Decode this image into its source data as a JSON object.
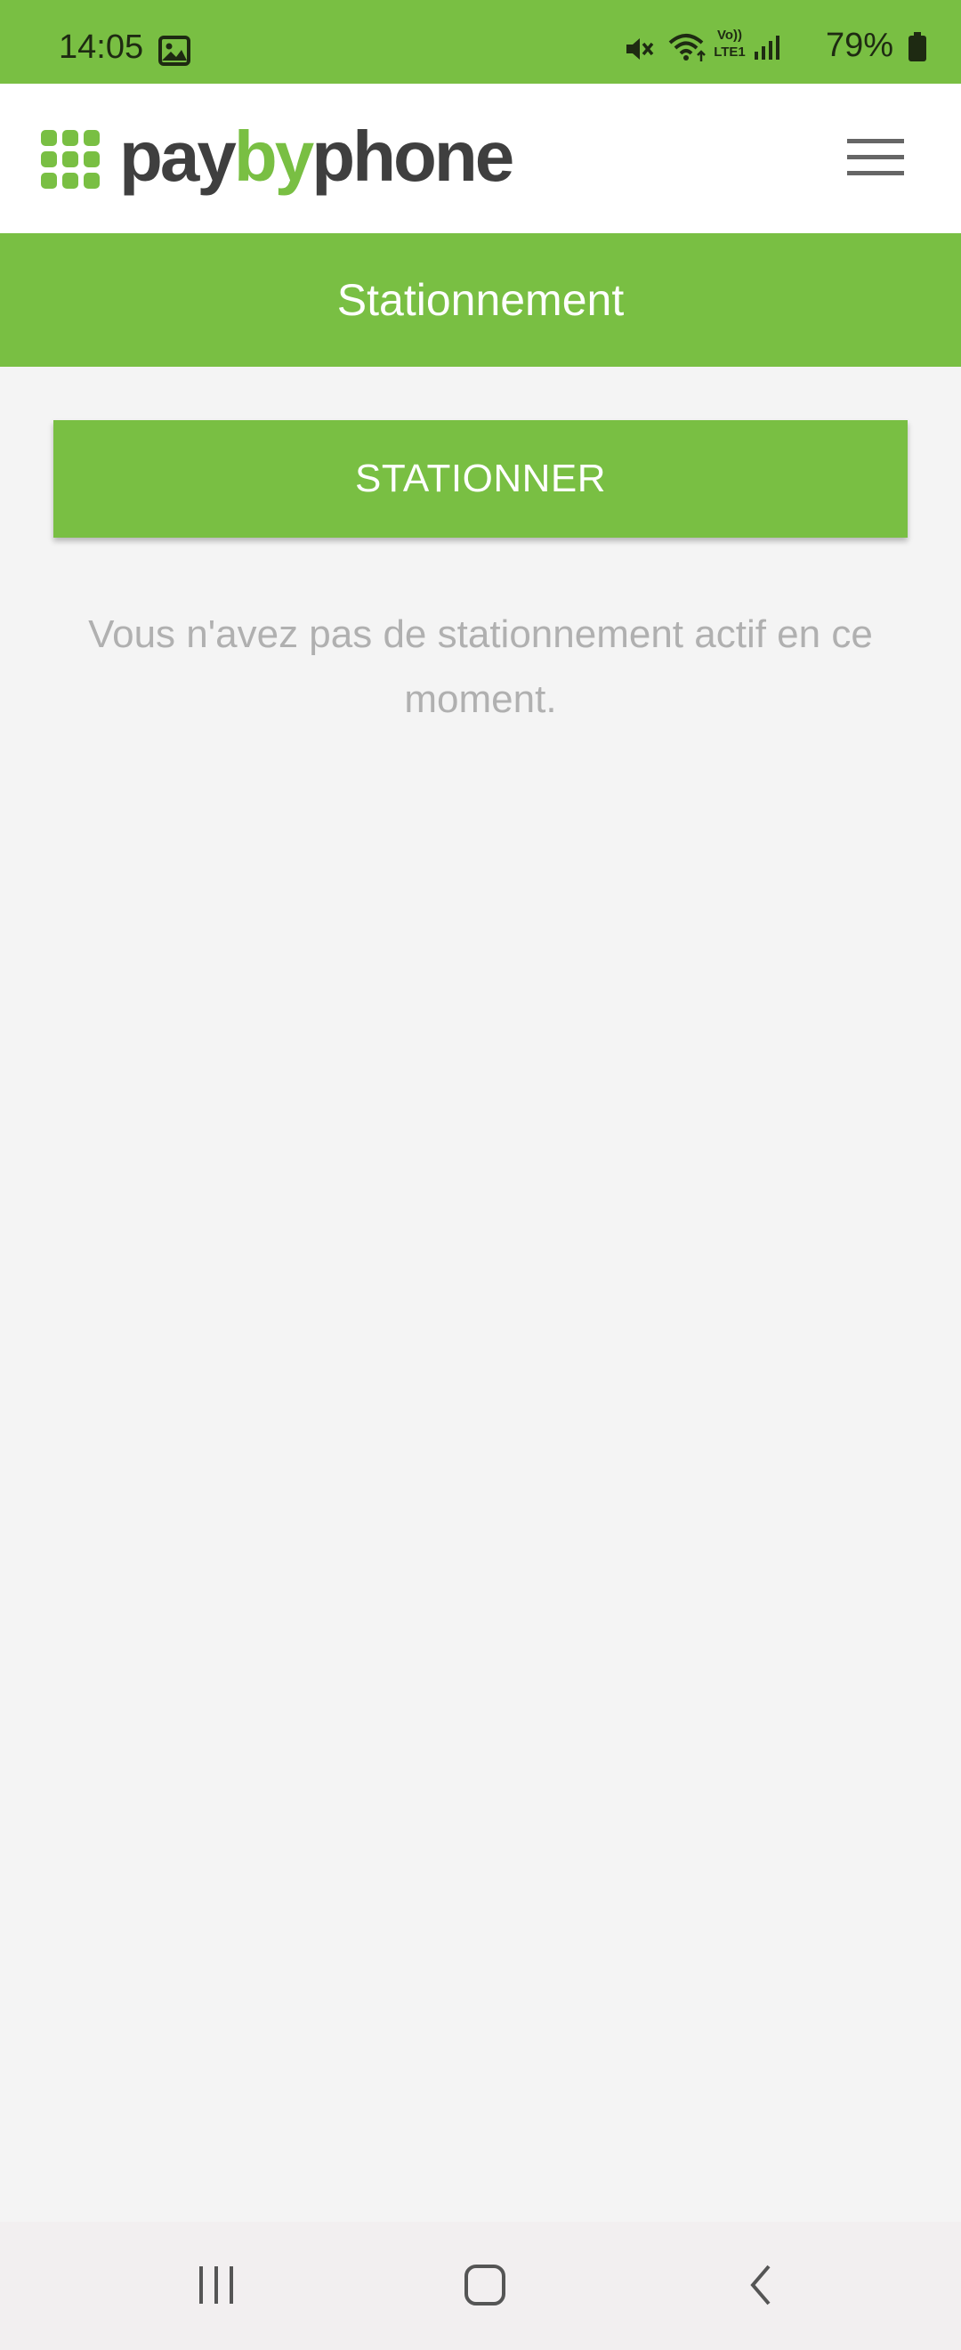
{
  "status_bar": {
    "time": "14:05",
    "battery_percent": "79%",
    "network_label_top": "Vo))",
    "network_label_bottom": "LTE1",
    "icons": [
      "gallery-icon",
      "mute-icon",
      "wifi-icon",
      "volte-icon",
      "signal-icon",
      "battery-icon"
    ]
  },
  "header": {
    "logo_pay": "pay",
    "logo_by": "by",
    "logo_phone": "phone",
    "menu_icon": "hamburger-menu-icon"
  },
  "title_bar": {
    "title": "Stationnement"
  },
  "main": {
    "park_button_label": "STATIONNER",
    "empty_message": "Vous n'avez pas de stationnement actif en ce moment."
  },
  "nav_bar": {
    "icons": [
      "recents-icon",
      "home-icon",
      "back-icon"
    ]
  },
  "colors": {
    "brand_green": "#79bf43",
    "logo_dark": "#3f3f3f",
    "background": "#f4f4f4",
    "muted_text": "#b0b0b0"
  }
}
